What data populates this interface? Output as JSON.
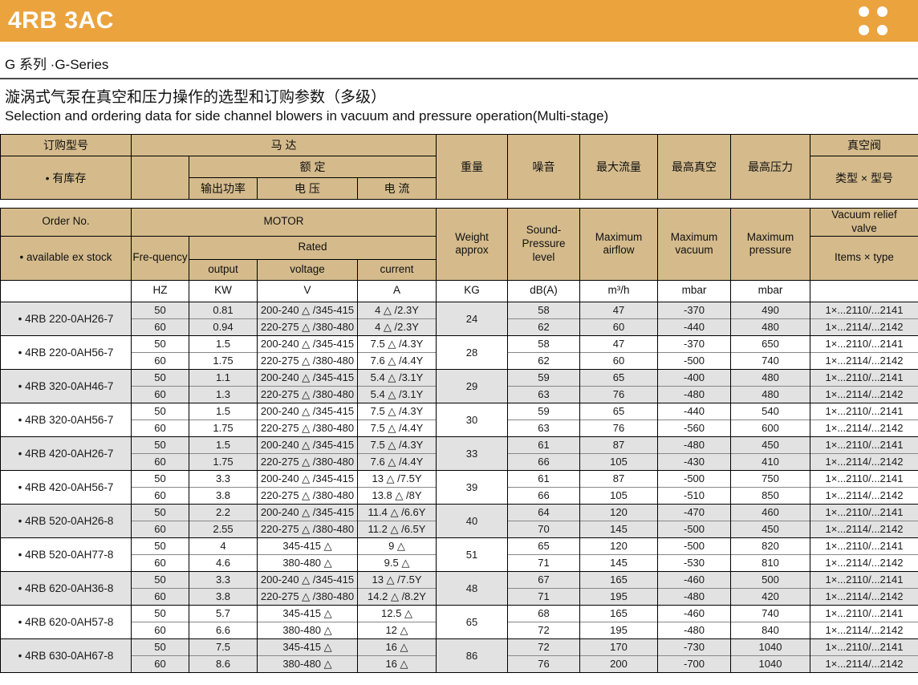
{
  "banner": {
    "title": "4RB 3AC"
  },
  "series_label": "G 系列 ·G-Series",
  "title_zh": "漩涡式气泵在真空和压力操作的选型和订购参数（多级）",
  "title_en": "Selection and ordering data for side channel blowers in vacuum and pressure operation(Multi-stage)",
  "colors": {
    "banner_orange": "#eba33e",
    "header_tan": "#d5bb8c",
    "row_gray": "#e2e2e2"
  },
  "header_zh": {
    "order_no": "订购型号",
    "motor": "马  达",
    "ex_stock": "• 有库存",
    "rated": "额  定",
    "output": "输出功率",
    "voltage": "电  压",
    "current": "电  流",
    "weight": "重量",
    "noise": "噪音",
    "max_airflow": "最大流量",
    "max_vacuum": "最高真空",
    "max_pressure": "最高压力",
    "vacuum_valve": "真空阀",
    "type_model": "类型 × 型号"
  },
  "header_en": {
    "order_no": "Order No.",
    "motor": "MOTOR",
    "ex_stock": "• available ex stock",
    "frequency": "Fre-quency",
    "rated": "Rated",
    "output": "output",
    "voltage": "voltage",
    "current": "current",
    "weight": "Weight\napprox",
    "noise": "Sound-\nPressure\nlevel",
    "max_airflow": "Maximum\nairflow",
    "max_vacuum": "Maximum\nvacuum",
    "max_pressure": "Maximum\npressure",
    "vacuum_valve": "Vacuum relief\nvalve",
    "type_model": "Items × type"
  },
  "units": {
    "hz": "HZ",
    "kw": "KW",
    "v": "V",
    "a": "A",
    "kg": "KG",
    "db": "dB(A)",
    "airflow": "m³/h",
    "vacuum": "mbar",
    "pressure": "mbar"
  },
  "groups": [
    {
      "model": "• 4RB 220-0AH26-7",
      "weight": "24",
      "rows": [
        {
          "hz": "50",
          "kw": "0.81",
          "voltage": "200-240 △ /345-415",
          "current": "4 △ /2.3Y",
          "db": "58",
          "airflow": "47",
          "vacuum": "-370",
          "pressure": "490",
          "valve": "1×...2110/...2141"
        },
        {
          "hz": "60",
          "kw": "0.94",
          "voltage": "220-275 △ /380-480",
          "current": "4 △ /2.3Y",
          "db": "62",
          "airflow": "60",
          "vacuum": "-440",
          "pressure": "480",
          "valve": "1×...2114/...2142"
        }
      ]
    },
    {
      "model": "• 4RB 220-0AH56-7",
      "weight": "28",
      "rows": [
        {
          "hz": "50",
          "kw": "1.5",
          "voltage": "200-240 △ /345-415",
          "current": "7.5 △ /4.3Y",
          "db": "58",
          "airflow": "47",
          "vacuum": "-370",
          "pressure": "650",
          "valve": "1×...2110/...2141"
        },
        {
          "hz": "60",
          "kw": "1.75",
          "voltage": "220-275 △ /380-480",
          "current": "7.6 △ /4.4Y",
          "db": "62",
          "airflow": "60",
          "vacuum": "-500",
          "pressure": "740",
          "valve": "1×...2114/...2142"
        }
      ]
    },
    {
      "model": "• 4RB 320-0AH46-7",
      "weight": "29",
      "rows": [
        {
          "hz": "50",
          "kw": "1.1",
          "voltage": "200-240 △ /345-415",
          "current": "5.4 △ /3.1Y",
          "db": "59",
          "airflow": "65",
          "vacuum": "-400",
          "pressure": "480",
          "valve": "1×...2110/...2141"
        },
        {
          "hz": "60",
          "kw": "1.3",
          "voltage": "220-275 △ /380-480",
          "current": "5.4 △ /3.1Y",
          "db": "63",
          "airflow": "76",
          "vacuum": "-480",
          "pressure": "480",
          "valve": "1×...2114/...2142"
        }
      ]
    },
    {
      "model": "• 4RB 320-0AH56-7",
      "weight": "30",
      "rows": [
        {
          "hz": "50",
          "kw": "1.5",
          "voltage": "200-240 △ /345-415",
          "current": "7.5 △ /4.3Y",
          "db": "59",
          "airflow": "65",
          "vacuum": "-440",
          "pressure": "540",
          "valve": "1×...2110/...2141"
        },
        {
          "hz": "60",
          "kw": "1.75",
          "voltage": "220-275 △ /380-480",
          "current": "7.5 △ /4.4Y",
          "db": "63",
          "airflow": "76",
          "vacuum": "-560",
          "pressure": "600",
          "valve": "1×...2114/...2142"
        }
      ]
    },
    {
      "model": "• 4RB 420-0AH26-7",
      "weight": "33",
      "rows": [
        {
          "hz": "50",
          "kw": "1.5",
          "voltage": "200-240 △ /345-415",
          "current": "7.5 △ /4.3Y",
          "db": "61",
          "airflow": "87",
          "vacuum": "-480",
          "pressure": "450",
          "valve": "1×...2110/...2141"
        },
        {
          "hz": "60",
          "kw": "1.75",
          "voltage": "220-275 △ /380-480",
          "current": "7.6 △ /4.4Y",
          "db": "66",
          "airflow": "105",
          "vacuum": "-430",
          "pressure": "410",
          "valve": "1×...2114/...2142"
        }
      ]
    },
    {
      "model": "• 4RB 420-0AH56-7",
      "weight": "39",
      "rows": [
        {
          "hz": "50",
          "kw": "3.3",
          "voltage": "200-240 △ /345-415",
          "current": "13 △ /7.5Y",
          "db": "61",
          "airflow": "87",
          "vacuum": "-500",
          "pressure": "750",
          "valve": "1×...2110/...2141"
        },
        {
          "hz": "60",
          "kw": "3.8",
          "voltage": "220-275 △ /380-480",
          "current": "13.8 △ /8Y",
          "db": "66",
          "airflow": "105",
          "vacuum": "-510",
          "pressure": "850",
          "valve": "1×...2114/...2142"
        }
      ]
    },
    {
      "model": "• 4RB 520-0AH26-8",
      "weight": "40",
      "rows": [
        {
          "hz": "50",
          "kw": "2.2",
          "voltage": "200-240 △ /345-415",
          "current": "11.4 △ /6.6Y",
          "db": "64",
          "airflow": "120",
          "vacuum": "-470",
          "pressure": "460",
          "valve": "1×...2110/...2141"
        },
        {
          "hz": "60",
          "kw": "2.55",
          "voltage": "220-275 △ /380-480",
          "current": "11.2 △ /6.5Y",
          "db": "70",
          "airflow": "145",
          "vacuum": "-500",
          "pressure": "450",
          "valve": "1×...2114/...2142"
        }
      ]
    },
    {
      "model": "• 4RB 520-0AH77-8",
      "weight": "51",
      "rows": [
        {
          "hz": "50",
          "kw": "4",
          "voltage": "345-415 △",
          "current": "9 △",
          "db": "65",
          "airflow": "120",
          "vacuum": "-500",
          "pressure": "820",
          "valve": "1×...2110/...2141"
        },
        {
          "hz": "60",
          "kw": "4.6",
          "voltage": "380-480 △",
          "current": "9.5 △",
          "db": "71",
          "airflow": "145",
          "vacuum": "-530",
          "pressure": "810",
          "valve": "1×...2114/...2142"
        }
      ]
    },
    {
      "model": "• 4RB 620-0AH36-8",
      "weight": "48",
      "rows": [
        {
          "hz": "50",
          "kw": "3.3",
          "voltage": "200-240 △ /345-415",
          "current": "13 △ /7.5Y",
          "db": "67",
          "airflow": "165",
          "vacuum": "-460",
          "pressure": "500",
          "valve": "1×...2110/...2141"
        },
        {
          "hz": "60",
          "kw": "3.8",
          "voltage": "220-275 △ /380-480",
          "current": "14.2 △ /8.2Y",
          "db": "71",
          "airflow": "195",
          "vacuum": "-480",
          "pressure": "420",
          "valve": "1×...2114/...2142"
        }
      ]
    },
    {
      "model": "• 4RB 620-0AH57-8",
      "weight": "65",
      "rows": [
        {
          "hz": "50",
          "kw": "5.7",
          "voltage": "345-415 △",
          "current": "12.5 △",
          "db": "68",
          "airflow": "165",
          "vacuum": "-460",
          "pressure": "740",
          "valve": "1×...2110/...2141"
        },
        {
          "hz": "60",
          "kw": "6.6",
          "voltage": "380-480 △",
          "current": "12 △",
          "db": "72",
          "airflow": "195",
          "vacuum": "-480",
          "pressure": "840",
          "valve": "1×...2114/...2142"
        }
      ]
    },
    {
      "model": "• 4RB 630-0AH67-8",
      "weight": "86",
      "rows": [
        {
          "hz": "50",
          "kw": "7.5",
          "voltage": "345-415 △",
          "current": "16 △",
          "db": "72",
          "airflow": "170",
          "vacuum": "-730",
          "pressure": "1040",
          "valve": "1×...2110/...2141"
        },
        {
          "hz": "60",
          "kw": "8.6",
          "voltage": "380-480 △",
          "current": "16 △",
          "db": "76",
          "airflow": "200",
          "vacuum": "-700",
          "pressure": "1040",
          "valve": "1×...2114/...2142"
        }
      ]
    }
  ]
}
